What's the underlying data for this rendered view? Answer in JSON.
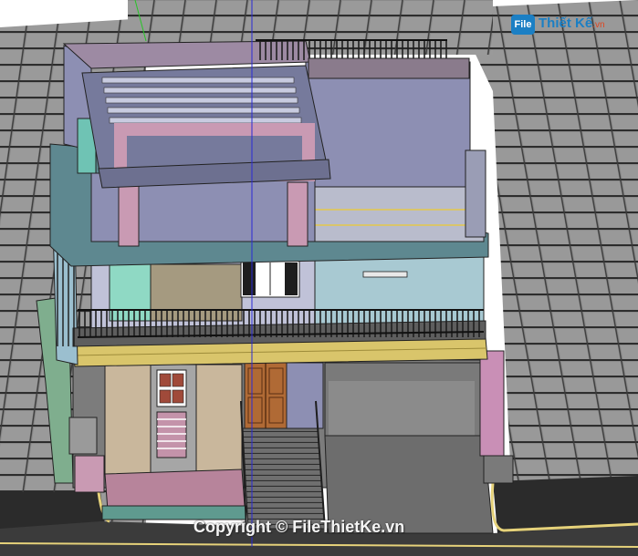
{
  "image": {
    "subject": "SketchUp 3D model render of a two-story townhouse with rooftop pergola",
    "palette": {
      "roof_tile": "#8f8f8f",
      "roof_line": "#2e2e2e",
      "wall_lavender": "#8d8fb3",
      "wall_mint": "#8fd9c4",
      "wall_beige": "#c9b79c",
      "trim_yellow": "#d9c56b",
      "pink_frame": "#c99ab3",
      "balcony_rail": "#222222",
      "slab_teal": "#5e8890",
      "door_wood": "#b06a35",
      "street_edge": "#e6d27a"
    }
  },
  "watermark": {
    "logo_badge": "File",
    "logo_main": "Thiết Kế",
    "logo_suffix": ".vn",
    "copyright": "Copyright © FileThietKe.vn"
  }
}
